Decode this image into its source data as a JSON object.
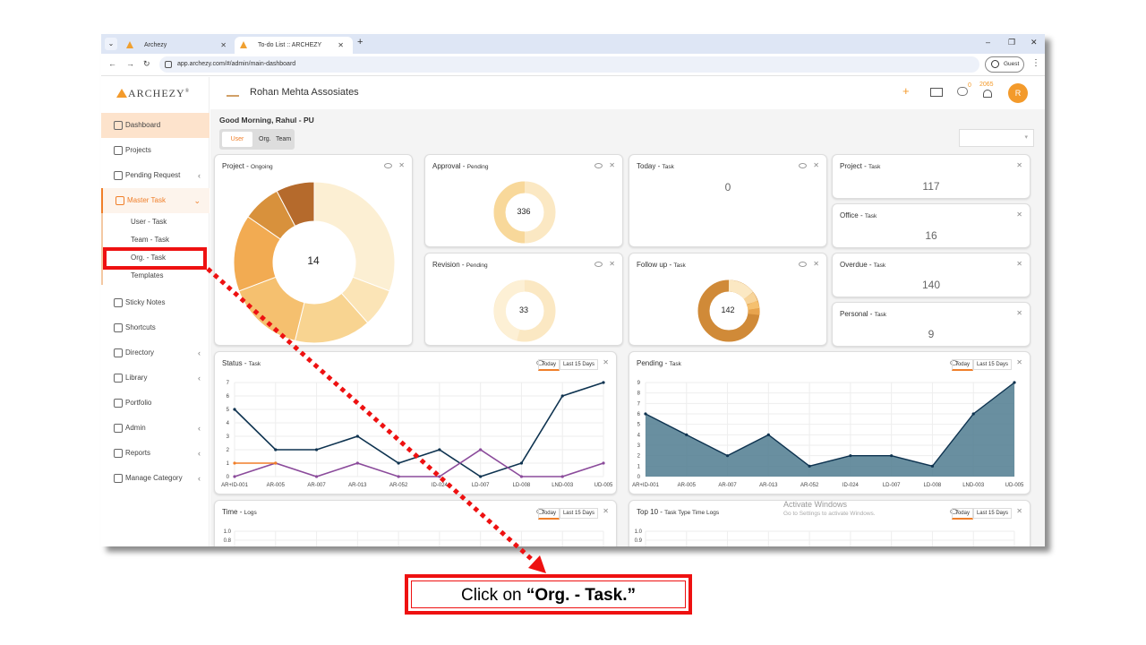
{
  "browser": {
    "tabs": [
      {
        "title": "Archezy"
      },
      {
        "title": "To-do List :: ARCHEZY"
      }
    ],
    "url": "app.archezy.com/#/admin/main-dashboard",
    "profile_label": "Guest"
  },
  "sidebar": {
    "logo": "ARCHEZY",
    "items": [
      {
        "label": "Dashboard"
      },
      {
        "label": "Projects"
      },
      {
        "label": "Pending Request"
      },
      {
        "label": "Master Task"
      },
      {
        "label": "Sticky Notes"
      },
      {
        "label": "Shortcuts"
      },
      {
        "label": "Directory"
      },
      {
        "label": "Library"
      },
      {
        "label": "Portfolio"
      },
      {
        "label": "Admin"
      },
      {
        "label": "Reports"
      },
      {
        "label": "Manage Category"
      }
    ],
    "master_sub": [
      {
        "label": "User - Task"
      },
      {
        "label": "Team - Task"
      },
      {
        "label": "Org. - Task"
      },
      {
        "label": "Templates"
      }
    ]
  },
  "header": {
    "company": "Rohan Mehta Assosiates",
    "chat_count": "0",
    "notification_count": "2065",
    "avatar_letter": "R"
  },
  "dashboard": {
    "greeting": "Good Morning, Rahul - PU",
    "view_toggle": [
      "User",
      "Org.",
      "Team"
    ],
    "cards": {
      "project": {
        "title": "Project",
        "sub": "Ongoing",
        "value": "14"
      },
      "approval": {
        "title": "Approval",
        "sub": "Pending",
        "value": "336"
      },
      "today": {
        "title": "Today",
        "sub": "Task",
        "value": "0"
      },
      "project_task": {
        "title": "Project",
        "sub": "Task",
        "value": "117"
      },
      "office_task": {
        "title": "Office",
        "sub": "Task",
        "value": "16"
      },
      "revision": {
        "title": "Revision",
        "sub": "Pending",
        "value": "33"
      },
      "followup": {
        "title": "Follow up",
        "sub": "Task",
        "value": "142"
      },
      "overdue": {
        "title": "Overdue",
        "sub": "Task",
        "value": "140"
      },
      "personal": {
        "title": "Personal",
        "sub": "Task",
        "value": "9"
      },
      "status": {
        "title": "Status",
        "sub": "Task"
      },
      "pending": {
        "title": "Pending",
        "sub": "Task"
      },
      "time": {
        "title": "Time",
        "sub": "Logs"
      },
      "top10": {
        "title": "Top 10",
        "sub": "Task Type Time Logs"
      }
    },
    "range_today": "Today",
    "range_15": "Last 15 Days"
  },
  "watermark": {
    "line1": "Activate Windows",
    "line2": "Go to Settings to activate Windows."
  },
  "annotation": {
    "instruction_prefix": "Click on ",
    "instruction_bold": "“Org. - Task.”"
  },
  "colors": {
    "accent": "#f07f2a",
    "annotation_red": "#ee1111",
    "line_navy": "#0e3350",
    "line_purple": "#8b4b9b",
    "area_fill": "#4f7b8f"
  },
  "chart_data": [
    {
      "type": "pie",
      "title": "Project - Ongoing",
      "center_value": 14,
      "values": [
        4,
        1,
        2,
        2,
        2,
        1,
        1
      ]
    },
    {
      "type": "line",
      "title": "Status - Task",
      "categories": [
        "AR+ID-001",
        "AR-005",
        "AR-007",
        "AR-013",
        "AR-052",
        "ID-024",
        "LD-007",
        "LD-008",
        "LND-003",
        "UD-005"
      ],
      "ylim": [
        0,
        7
      ],
      "yticks": [
        0,
        1,
        2,
        3,
        4,
        5,
        6,
        7
      ],
      "series": [
        {
          "values": [
            5,
            2,
            2,
            3,
            1,
            2,
            0,
            1,
            6,
            7
          ]
        },
        {
          "values": [
            0,
            1,
            0,
            1,
            0,
            0,
            2,
            0,
            0,
            1
          ]
        },
        {
          "values": [
            1,
            1,
            0,
            0,
            0,
            0,
            0,
            0,
            0,
            0
          ]
        }
      ]
    },
    {
      "type": "area",
      "title": "Pending - Task",
      "categories": [
        "AR+ID-001",
        "AR-005",
        "AR-007",
        "AR-013",
        "AR-052",
        "ID-024",
        "LD-007",
        "LD-008",
        "LND-003",
        "UD-005"
      ],
      "ylim": [
        0,
        9
      ],
      "yticks": [
        0,
        1,
        2,
        3,
        4,
        5,
        6,
        7,
        8,
        9
      ],
      "values": [
        6,
        4,
        2,
        4,
        1,
        2,
        2,
        1,
        6,
        9
      ]
    },
    {
      "type": "line",
      "title": "Time - Logs",
      "yticks": [
        1.0,
        0.8
      ]
    },
    {
      "type": "bar",
      "title": "Top 10 - Task Type Time Logs",
      "yticks": [
        1.0,
        0.9
      ]
    }
  ]
}
